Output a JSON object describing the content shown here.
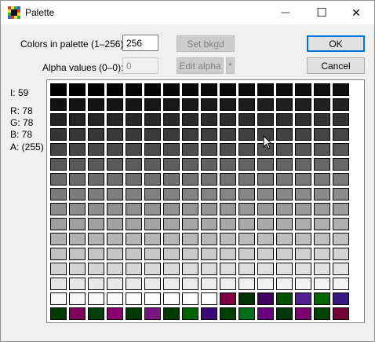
{
  "window": {
    "title": "Palette",
    "minimize_glyph": "—",
    "maximize_glyph": "☐",
    "close_glyph": "✕"
  },
  "controls": {
    "colors_label": "Colors in palette (1–256):",
    "colors_value": "256",
    "alpha_label": "Alpha values (0–0):",
    "alpha_value": "0",
    "set_bkgd": "Set bkgd",
    "edit_alpha": "Edit alpha",
    "star": "*",
    "ok": "OK",
    "cancel": "Cancel"
  },
  "info": {
    "index": "I: 59",
    "r": "R: 78",
    "g": "G: 78",
    "b": "B: 78",
    "a": "A: (255)"
  },
  "colors": {
    "accent": "#0078d7",
    "border": "#000000"
  },
  "palette": {
    "extra_colors": [
      "#800040",
      "#003300",
      "#400060",
      "#005000",
      "#50208f",
      "#006600",
      "#3a1780",
      "#003c00",
      "#80005a",
      "#00400a",
      "#8a006e",
      "#003a00",
      "#7b1480",
      "#003c00",
      "#006400",
      "#3c0878",
      "#004000",
      "#006f1a",
      "#680080",
      "#00380e",
      "#7c0070",
      "#004400",
      "#760038",
      "#001e00",
      "#6e0000"
    ]
  }
}
